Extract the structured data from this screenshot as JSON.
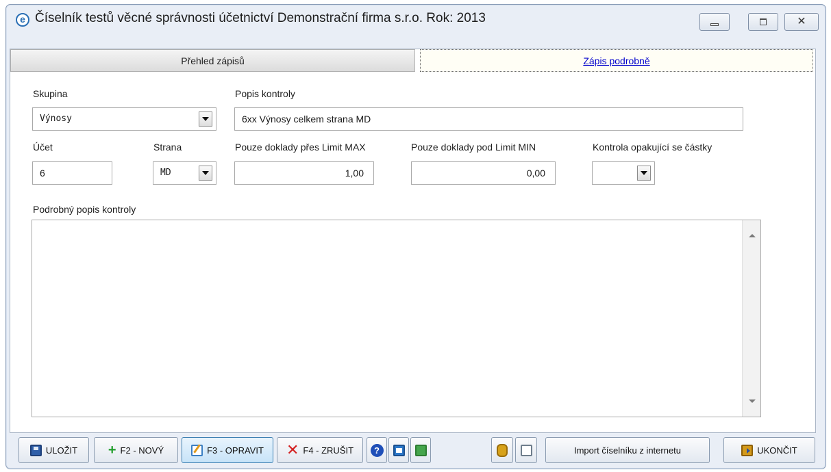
{
  "window": {
    "title": "Číselník testů věcné správnosti účetnictví  Demonstrační firma s.r.o.  Rok: 2013",
    "app_icon": "e"
  },
  "tabs": [
    {
      "label": "Přehled zápisů",
      "active": false
    },
    {
      "label": "Zápis podrobně",
      "active": true
    }
  ],
  "form": {
    "skupina": {
      "label": "Skupina",
      "value": "Výnosy"
    },
    "popis_kontroly": {
      "label": "Popis kontroly",
      "value": "6xx Výnosy celkem strana MD"
    },
    "ucet": {
      "label": "Účet",
      "value": "6"
    },
    "strana": {
      "label": "Strana",
      "value": "MD"
    },
    "limit_max": {
      "label": "Pouze doklady přes Limit MAX",
      "value": "1,00"
    },
    "limit_min": {
      "label": "Pouze doklady pod Limit MIN",
      "value": "0,00"
    },
    "kontrola_opakujici": {
      "label": "Kontrola opakující se částky",
      "value": ""
    },
    "podrobny_popis": {
      "label": "Podrobný popis kontroly",
      "value": ""
    }
  },
  "toolbar": {
    "save": "ULOŽIT",
    "new": "F2 - NOVÝ",
    "edit": "F3 - OPRAVIT",
    "cancel": "F4 - ZRUŠIT",
    "help_glyph": "?",
    "import": "Import číselníku z internetu",
    "exit": "UKONČIT"
  },
  "icons": {
    "save": "floppy-disk-icon",
    "new": "plus-icon",
    "edit": "edit-icon",
    "cancel": "cross-icon",
    "help": "help-icon",
    "card": "card-icon",
    "sheet": "sheet-icon",
    "bag": "money-bag-icon",
    "filter": "filter-icon",
    "exit": "exit-door-icon"
  }
}
